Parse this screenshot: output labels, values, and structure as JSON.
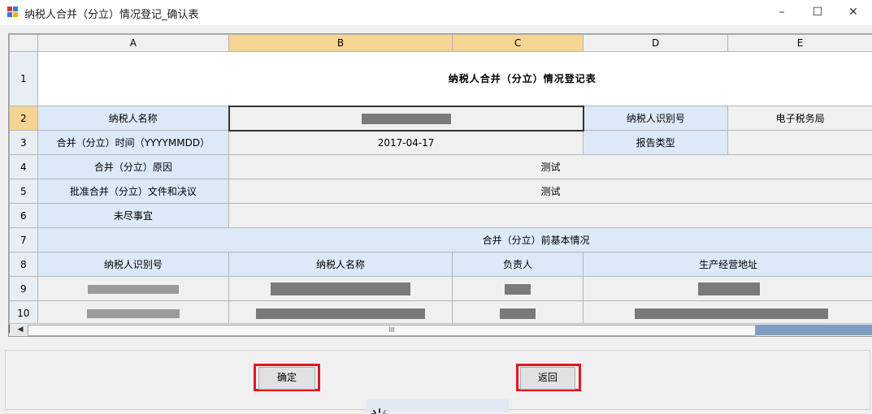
{
  "window": {
    "title": "纳税人合并（分立）情况登记_确认表",
    "minimize": "–",
    "maximize": "☐",
    "close": "✕"
  },
  "sheet": {
    "columns": [
      "A",
      "B",
      "C",
      "D",
      "E"
    ],
    "rows": [
      "1",
      "2",
      "3",
      "4",
      "5",
      "6",
      "7",
      "8",
      "9",
      "10"
    ],
    "title": "纳税人合并（分立）情况登记表",
    "taxpayer_name_label": "纳税人名称",
    "taxpayer_id_label": "纳税人识别号",
    "taxpayer_id_value": "电子税务局",
    "merge_time_label": "合并（分立）时间（YYYYMMDD）",
    "merge_time_value": "2017-04-17",
    "report_type_label": "报告类型",
    "reason_label": "合并（分立）原因",
    "reason_value": "测试",
    "approval_label": "批准合并（分立）文件和决议",
    "approval_value": "测试",
    "pending_label": "未尽事宜",
    "section_title": "合并（分立）前基本情况",
    "list_headers": [
      "纳税人识别号",
      "纳税人名称",
      "负责人",
      "生产经营地址"
    ]
  },
  "scrollbar": {
    "thumb_grip": "III"
  },
  "buttons": {
    "confirm": "确定",
    "back": "返回"
  },
  "colors": {
    "highlight": "#e0191f",
    "header_selected": "#f6d592",
    "label_cell": "#dbe9f9"
  }
}
